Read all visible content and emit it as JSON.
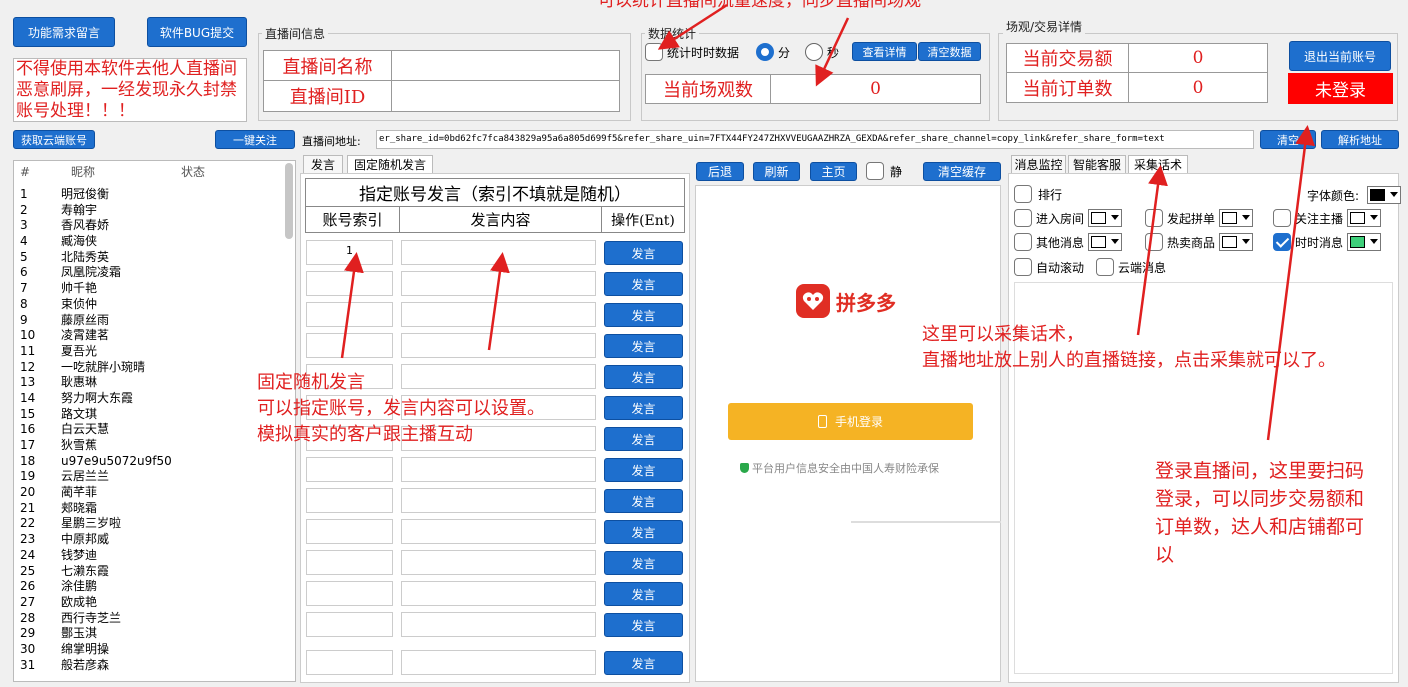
{
  "top": {
    "feature_btn": "功能需求留言",
    "bug_btn": "软件BUG提交",
    "warning": "不得使用本软件去他人直播间恶意刷屏，一经发现永久封禁账号处理！！！"
  },
  "room_info": {
    "group_label": "直播间信息",
    "name_label": "直播间名称",
    "id_label": "直播间ID",
    "name_value": "",
    "id_value": ""
  },
  "stats": {
    "group_label": "数据统计",
    "realtime_chk": "统计时时数据",
    "opt_min": "分",
    "opt_sec": "秒",
    "detail_btn": "查看详情",
    "clear_btn": "清空数据",
    "views_label": "当前场观数",
    "views_value": "0"
  },
  "trade": {
    "group_label": "场观/交易详情",
    "amount_label": "当前交易额",
    "amount_value": "0",
    "orders_label": "当前订单数",
    "orders_value": "0",
    "logout_btn": "退出当前账号",
    "status": "未登录"
  },
  "url_bar": {
    "get_accounts_btn": "获取云端账号",
    "follow_btn": "一键关注",
    "label": "直播间地址:",
    "value": "er_share_id=0bd62fc7fca843829a95a6a805d699f5&refer_share_uin=7FTX44FY247ZHXVVEUGAAZHRZA_GEXDA&refer_share_channel=copy_link&refer_share_form=text",
    "clear_btn": "清空",
    "parse_btn": "解析地址"
  },
  "accounts": {
    "col_idx": "#",
    "col_name": "昵称",
    "col_status": "状态",
    "rows": [
      [
        "1",
        "明冠俊衡"
      ],
      [
        "2",
        "寿翰宇"
      ],
      [
        "3",
        "香风春娇"
      ],
      [
        "4",
        "臧海侠"
      ],
      [
        "5",
        "北陆秀英"
      ],
      [
        "6",
        "凤凰院凌霜"
      ],
      [
        "7",
        "帅千艳"
      ],
      [
        "8",
        "束侦仲"
      ],
      [
        "9",
        "藤原丝雨"
      ],
      [
        "10",
        "凌霄建茗"
      ],
      [
        "11",
        "夏吾光"
      ],
      [
        "12",
        "一吃就胖小琬晴"
      ],
      [
        "13",
        "耿惠琳"
      ],
      [
        "14",
        "努力啊大东霞"
      ],
      [
        "15",
        "路文琪"
      ],
      [
        "16",
        "白云天慧"
      ],
      [
        "17",
        "狄雪蕉"
      ],
      [
        "18",
        "u97e9u5072u9f50"
      ],
      [
        "19",
        "云居兰兰"
      ],
      [
        "20",
        "蔺芊菲"
      ],
      [
        "21",
        "郏晓霜"
      ],
      [
        "22",
        "星鹏三岁啦"
      ],
      [
        "23",
        "中原邦威"
      ],
      [
        "24",
        "钱梦迪"
      ],
      [
        "25",
        "七濑东霞"
      ],
      [
        "26",
        "涂佳鹏"
      ],
      [
        "27",
        "欧成艳"
      ],
      [
        "28",
        "西行寺芝兰"
      ],
      [
        "29",
        "酆玉淇"
      ],
      [
        "30",
        "绵掌明操"
      ],
      [
        "31",
        "般若彦森"
      ]
    ]
  },
  "speak": {
    "tab1": "发言",
    "tab2": "固定随机发言",
    "title": "指定账号发言（索引不填就是随机）",
    "col_index": "账号索引",
    "col_content": "发言内容",
    "col_action": "操作(Ent)",
    "first_index": "1",
    "send_label": "发言"
  },
  "browser": {
    "back": "后退",
    "refresh": "刷新",
    "home": "主页",
    "mute": "静",
    "clear_cache": "清空缓存",
    "brand": "拼多多",
    "login_btn": "手机登录",
    "notice": "平台用户信息安全由中国人寿财险承保"
  },
  "monitor": {
    "tab1": "消息监控",
    "tab2": "智能客服",
    "tab3": "采集话术",
    "rank": "排行",
    "font_color": "字体颜色:",
    "enter_room": "进入房间",
    "group_buy": "发起拼单",
    "follow_host": "关注主播",
    "other_msg": "其他消息",
    "hot_goods": "热卖商品",
    "realtime_msg": "时时消息",
    "auto_scroll": "自动滚动",
    "cloud_msg": "云端消息"
  },
  "annotations": {
    "top": "可以统计直播间流量速度，同步直播间场观",
    "middle": [
      "固定随机发言",
      "可以指定账号，发言内容可以设置。",
      "模拟真实的客户跟主播互动"
    ],
    "collect": [
      "这里可以采集话术，",
      "直播地址放上别人的直播链接，点击采集就可以了。"
    ],
    "login": [
      "登录直播间，这里要扫码",
      "登录，可以同步交易额和",
      "订单数，达人和店铺都可",
      "以"
    ]
  },
  "colors": {
    "accent": "#1e6fce",
    "annotation": "#e02020",
    "status_bg": "#ff0000",
    "login_btn": "#f5b324"
  }
}
